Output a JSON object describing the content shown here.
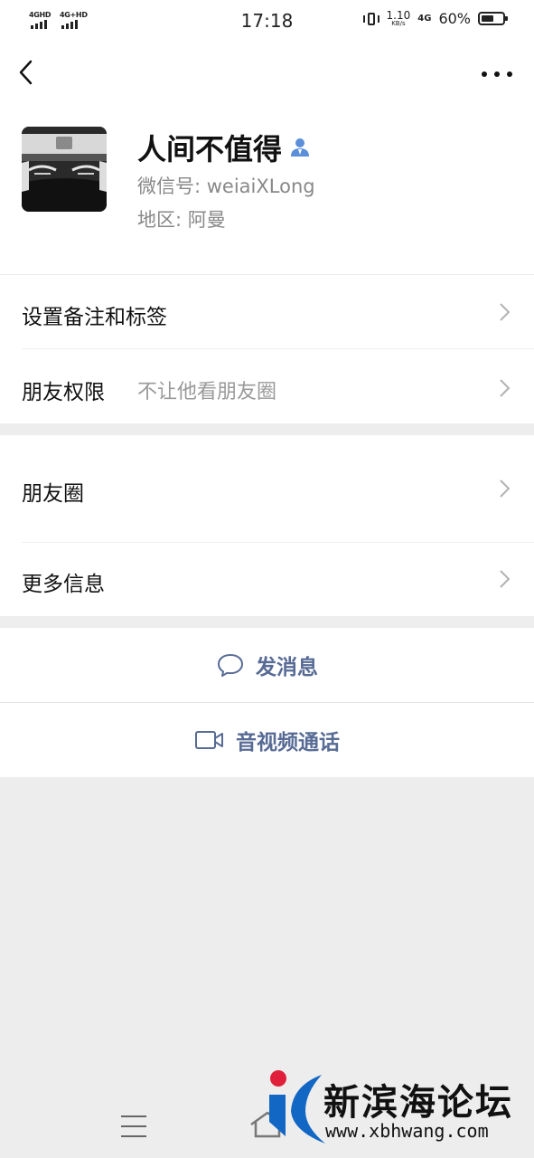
{
  "status_bar": {
    "sim1_label": "4GHD",
    "sim2_label": "4G+HD",
    "time": "17:18",
    "speed_value": "1.10",
    "speed_unit": "KB/s",
    "network_label": "4G",
    "battery_percent": "60%",
    "battery_level": 0.6
  },
  "profile": {
    "name": "人间不值得",
    "wechat_id": "微信号: weiaiXLong",
    "region": "地区: 阿曼",
    "gender_icon": "male-icon"
  },
  "rows": {
    "remark_tags": "设置备注和标签",
    "friend_permission": "朋友权限",
    "friend_permission_value": "不让他看朋友圈",
    "moments": "朋友圈",
    "more_info": "更多信息"
  },
  "actions": {
    "send_message": "发消息",
    "video_call": "音视频通话"
  },
  "watermark": {
    "text": "新滨海论坛",
    "url": "www.xbhwang.com"
  },
  "colors": {
    "accent_link": "#576b95",
    "background": "#ededed",
    "card": "#ffffff"
  }
}
